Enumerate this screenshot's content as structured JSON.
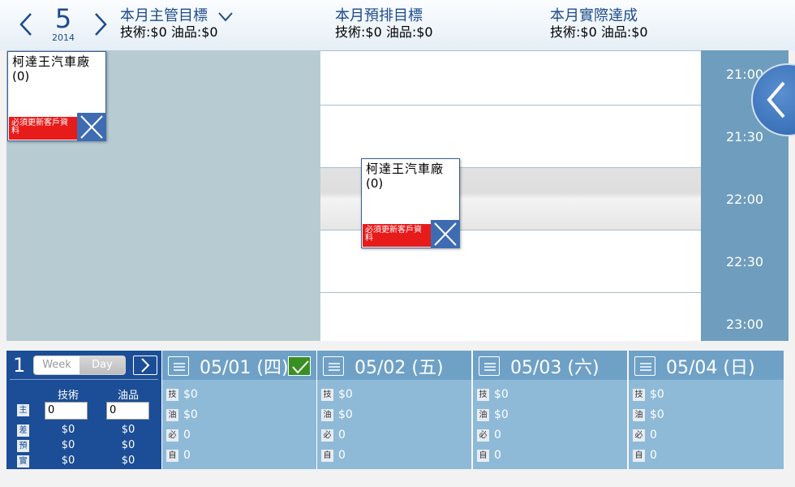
{
  "header": {
    "month": "5",
    "year": "2014",
    "columns": [
      {
        "title": "本月主管目標",
        "values": "技術:$0 油品:$0"
      },
      {
        "title": "本月預排目標",
        "values": "技術:$0 油品:$0"
      },
      {
        "title": "本月實際達成",
        "values": "技術:$0 油品:$0"
      }
    ]
  },
  "times": [
    "21:00",
    "21:30",
    "22:00",
    "22:30",
    "23:00"
  ],
  "cards": [
    {
      "name": "柯達王汽車廠",
      "count": "(0)",
      "warning": "必須更新客戶資料"
    },
    {
      "name": "柯達王汽車廠",
      "count": "(0)",
      "warning": "必須更新客戶資料"
    }
  ],
  "summary": {
    "week_number": "1",
    "week_label": "Week",
    "day_label": "Day",
    "col_tech": "技術",
    "col_oil": "油品",
    "rows": [
      {
        "label": "主",
        "tech": "0",
        "oil": "0"
      },
      {
        "label": "差",
        "tech": "$0",
        "oil": "$0"
      },
      {
        "label": "預",
        "tech": "$0",
        "oil": "$0"
      },
      {
        "label": "實",
        "tech": "$0",
        "oil": "$0"
      }
    ]
  },
  "days": [
    {
      "date": "05/01 (四)",
      "checked": true,
      "rows": [
        {
          "k": "技",
          "v": "$0"
        },
        {
          "k": "油",
          "v": "$0"
        },
        {
          "k": "必",
          "v": "0"
        },
        {
          "k": "自",
          "v": "0"
        }
      ]
    },
    {
      "date": "05/02 (五)",
      "checked": false,
      "rows": [
        {
          "k": "技",
          "v": "$0"
        },
        {
          "k": "油",
          "v": "$0"
        },
        {
          "k": "必",
          "v": "0"
        },
        {
          "k": "自",
          "v": "0"
        }
      ]
    },
    {
      "date": "05/03 (六)",
      "checked": false,
      "rows": [
        {
          "k": "技",
          "v": "$0"
        },
        {
          "k": "油",
          "v": "$0"
        },
        {
          "k": "必",
          "v": "0"
        },
        {
          "k": "自",
          "v": "0"
        }
      ]
    },
    {
      "date": "05/04 (日)",
      "checked": false,
      "rows": [
        {
          "k": "技",
          "v": "$0"
        },
        {
          "k": "油",
          "v": "$0"
        },
        {
          "k": "必",
          "v": "0"
        },
        {
          "k": "自",
          "v": "0"
        }
      ]
    }
  ],
  "colors": {
    "accent": "#1c4d97",
    "warning": "#e81b1b",
    "check": "#3a8f22",
    "time_column": "#6f9dbd"
  },
  "icons": [
    "chevron-left-icon",
    "chevron-right-icon",
    "chevron-down-icon",
    "close-icon",
    "menu-icon",
    "check-icon"
  ]
}
